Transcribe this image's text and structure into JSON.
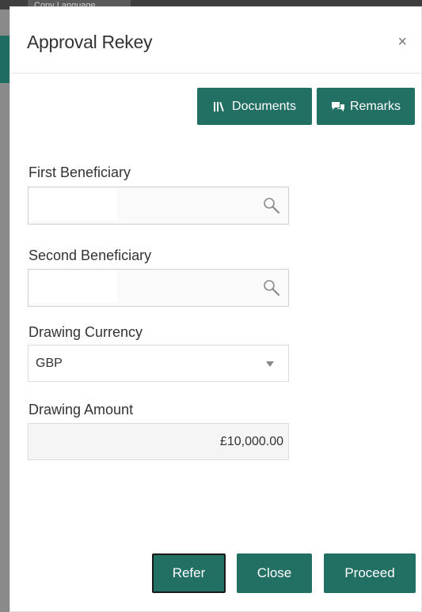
{
  "background": {
    "tab_fragment": "Copy Language"
  },
  "modal": {
    "title": "Approval Rekey",
    "close_symbol": "×",
    "documents_label": "Documents",
    "remarks_label": "Remarks",
    "fields": {
      "first_beneficiary": {
        "label": "First Beneficiary",
        "value": ""
      },
      "second_beneficiary": {
        "label": "Second Beneficiary",
        "value": ""
      },
      "drawing_currency": {
        "label": "Drawing Currency",
        "value": "GBP"
      },
      "drawing_amount": {
        "label": "Drawing Amount",
        "value": "£10,000.00"
      }
    },
    "footer": {
      "refer_label": "Refer",
      "close_label": "Close",
      "proceed_label": "Proceed"
    }
  },
  "colors": {
    "accent": "#226f63",
    "overlay": "#8a8a8a"
  },
  "icons": {
    "documents": "library-books-icon",
    "remarks": "chat-bubbles-icon",
    "lookup": "search-icon",
    "dropdown": "caret-down-icon",
    "close": "close-icon"
  }
}
